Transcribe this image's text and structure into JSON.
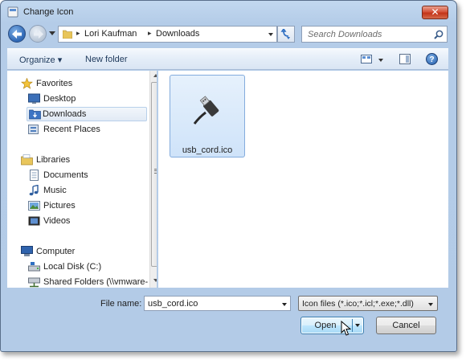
{
  "window": {
    "title": "Change Icon",
    "close_label": "✕"
  },
  "addressbar": {
    "segments": [
      "Lori Kaufman",
      "Downloads"
    ],
    "separator": "▸"
  },
  "search": {
    "placeholder": "Search Downloads"
  },
  "toolbar": {
    "organize_label": "Organize ▾",
    "new_folder_label": "New folder",
    "help_label": "?"
  },
  "navpane": {
    "items": [
      {
        "label": "Favorites",
        "icon": "star-icon"
      },
      {
        "label": "Desktop",
        "icon": "desktop-icon"
      },
      {
        "label": "Downloads",
        "icon": "downloads-folder-icon",
        "selected": true
      },
      {
        "label": "Recent Places",
        "icon": "recent-places-icon"
      },
      {
        "label": "Libraries",
        "icon": "libraries-icon"
      },
      {
        "label": "Documents",
        "icon": "documents-icon"
      },
      {
        "label": "Music",
        "icon": "music-icon"
      },
      {
        "label": "Pictures",
        "icon": "pictures-icon"
      },
      {
        "label": "Videos",
        "icon": "videos-icon"
      },
      {
        "label": "Computer",
        "icon": "computer-icon"
      },
      {
        "label": "Local Disk (C:)",
        "icon": "local-disk-icon"
      },
      {
        "label": "Shared Folders (\\\\vmware-",
        "icon": "network-drive-icon"
      }
    ]
  },
  "files": [
    {
      "name": "usb_cord.ico",
      "icon": "usb-cord-icon",
      "selected": true
    }
  ],
  "bottom": {
    "filename_label": "File name:",
    "filename_value": "usb_cord.ico",
    "filetype_value": "Icon files (*.ico;*.icl;*.exe;*.dll)",
    "open_label": "Open",
    "cancel_label": "Cancel"
  }
}
